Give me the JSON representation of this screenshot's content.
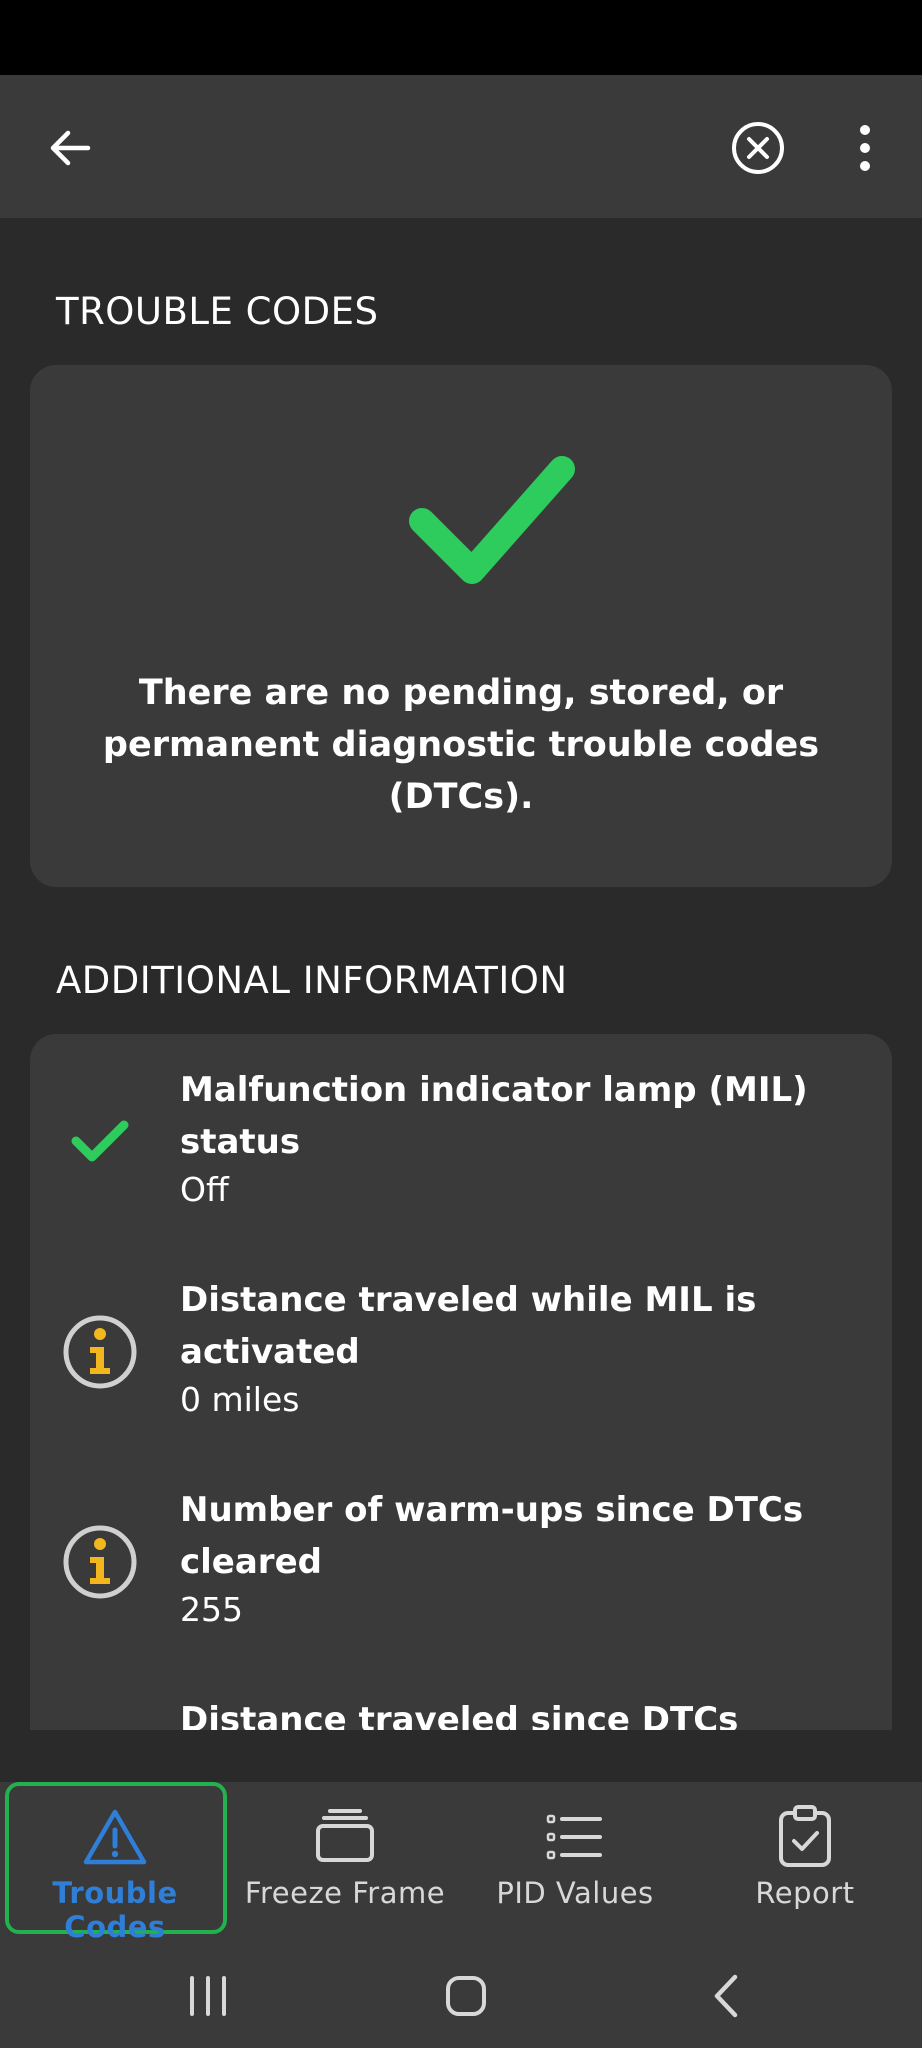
{
  "header": {
    "back_icon": "arrow-left-icon",
    "cancel_icon": "circle-x-icon",
    "more_icon": "vertical-dots-icon"
  },
  "trouble_codes": {
    "section_title": "TROUBLE CODES",
    "status_icon": "checkmark-icon",
    "status_color": "#2ecc5c",
    "message": "There are no pending, stored, or permanent diagnostic trouble codes (DTCs)."
  },
  "additional_info": {
    "section_title": "ADDITIONAL INFORMATION",
    "items": [
      {
        "icon": "checkmark-icon",
        "title": "Malfunction indicator lamp (MIL) status",
        "value": "Off"
      },
      {
        "icon": "info-icon",
        "title": "Distance traveled while MIL is activated",
        "value": "0 miles"
      },
      {
        "icon": "info-icon",
        "title": "Number of warm-ups since DTCs cleared",
        "value": "255"
      },
      {
        "icon": "info-icon",
        "title": "Distance traveled since DTCs cleared",
        "value": ""
      }
    ]
  },
  "bottom_nav": {
    "active_color": "#2f7fd8",
    "highlight_color": "#22b14c",
    "tabs": [
      {
        "label": "Trouble Codes",
        "icon": "warning-triangle-icon",
        "active": true
      },
      {
        "label": "Freeze Frame",
        "icon": "stacked-frames-icon",
        "active": false
      },
      {
        "label": "PID Values",
        "icon": "list-icon",
        "active": false
      },
      {
        "label": "Report",
        "icon": "clipboard-check-icon",
        "active": false
      }
    ]
  },
  "system_nav": {
    "recents_icon": "recents-icon",
    "home_icon": "home-icon",
    "back_icon": "chevron-left-icon"
  }
}
